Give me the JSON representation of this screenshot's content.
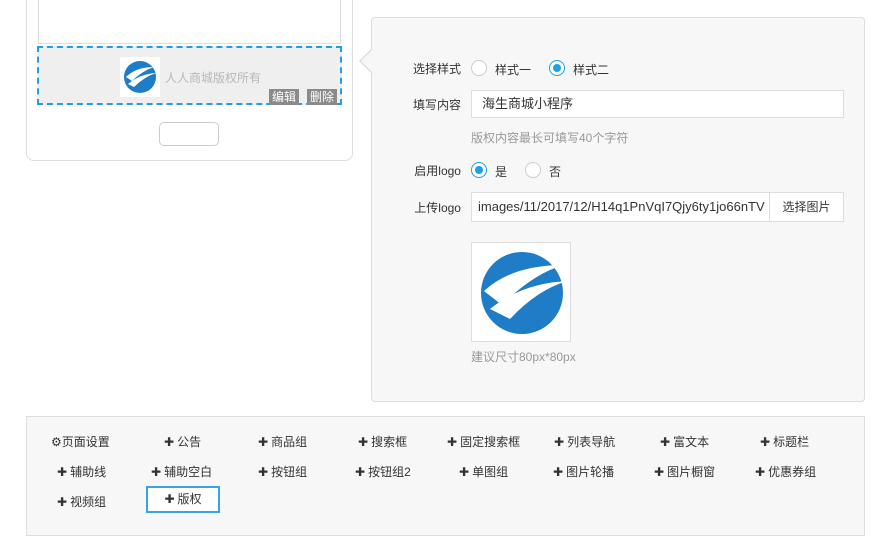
{
  "preview": {
    "copyright_text": "人人商城版权所有",
    "edit_label": "编辑",
    "delete_label": "删除"
  },
  "editor": {
    "style_label": "选择样式",
    "style_options": [
      "样式一",
      "样式二"
    ],
    "style_selected": "样式二",
    "content_label": "填写内容",
    "content_value": "海生商城小程序",
    "content_hint": "版权内容最长可填写40个字符",
    "logo_enable_label": "启用logo",
    "logo_enable_options": [
      "是",
      "否"
    ],
    "logo_enable_selected": "是",
    "upload_label": "上传logo",
    "upload_value": "images/11/2017/12/H14q1PnVqI7Qjy6ty1jo66nTV",
    "select_image_label": "选择图片",
    "size_hint": "建议尺寸80px*80px"
  },
  "toolbar": {
    "settings_label": "页面设置",
    "items": [
      "公告",
      "商品组",
      "搜索框",
      "固定搜索框",
      "列表导航",
      "富文本",
      "标题栏",
      "辅助线",
      "辅助空白",
      "按钮组",
      "按钮组2",
      "单图组",
      "图片轮播",
      "图片橱窗",
      "优惠券组",
      "视频组",
      "版权"
    ],
    "active_item": "版权"
  },
  "colors": {
    "accent": "#1e9fe6",
    "logo_blue": "#1f7cc6"
  }
}
